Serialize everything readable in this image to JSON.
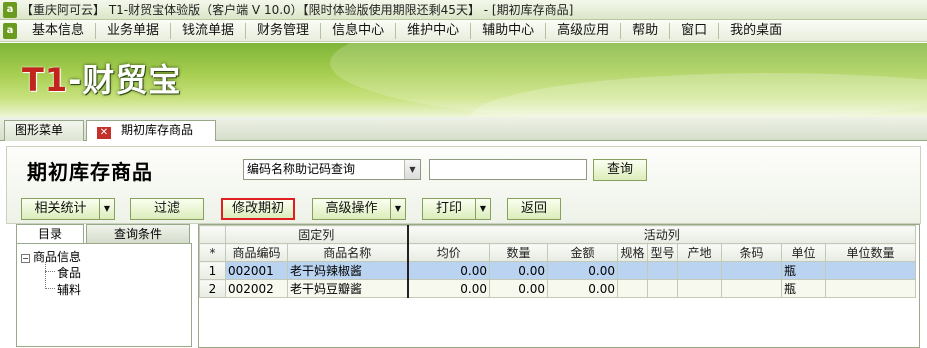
{
  "window": {
    "title": "【重庆阿可云】 T1-财贸宝体验版（客户端 V 10.0）【限时体验版使用期限还剩45天】 - [期初库存商品]",
    "app_icon": "app-logo-icon"
  },
  "menu": {
    "items": [
      "基本信息",
      "业务单据",
      "钱流单据",
      "财务管理",
      "信息中心",
      "维护中心",
      "辅助中心",
      "高级应用",
      "帮助",
      "窗口",
      "我的桌面"
    ]
  },
  "banner": {
    "logo_prefix": "T1",
    "logo_rest": "-财贸宝"
  },
  "tabs": {
    "items": [
      {
        "label": "图形菜单"
      },
      {
        "label": "期初库存商品",
        "close_icon": "close-icon"
      }
    ]
  },
  "page": {
    "title": "期初库存商品",
    "search_mode": "编码名称助记码查询",
    "search_value": "",
    "query_label": "查询"
  },
  "toolbar": {
    "stats_label": "相关统计",
    "filter_label": "过滤",
    "modify_label": "修改期初",
    "advanced_label": "高级操作",
    "print_label": "打印",
    "back_label": "返回"
  },
  "left_panel": {
    "tabs": [
      "目录",
      "查询条件"
    ],
    "tree": {
      "root": "商品信息",
      "root_toggle": "−",
      "children": [
        "食品",
        "辅料"
      ]
    }
  },
  "grid": {
    "groups": {
      "fixed": "固定列",
      "active": "活动列"
    },
    "index_header": "*",
    "columns": [
      "商品编码",
      "商品名称",
      "均价",
      "数量",
      "金额",
      "规格",
      "型号",
      "产地",
      "条码",
      "单位",
      "单位数量"
    ],
    "rows": [
      {
        "idx": "1",
        "code": "002001",
        "name": "老干妈辣椒酱",
        "avg_price": "0.00",
        "qty": "0.00",
        "amount": "0.00",
        "spec": "",
        "model": "",
        "origin": "",
        "barcode": "",
        "unit": "瓶",
        "unit_qty": "",
        "selected": true
      },
      {
        "idx": "2",
        "code": "002002",
        "name": "老干妈豆瓣酱",
        "avg_price": "0.00",
        "qty": "0.00",
        "amount": "0.00",
        "spec": "",
        "model": "",
        "origin": "",
        "barcode": "",
        "unit": "瓶",
        "unit_qty": "",
        "selected": false
      }
    ]
  }
}
